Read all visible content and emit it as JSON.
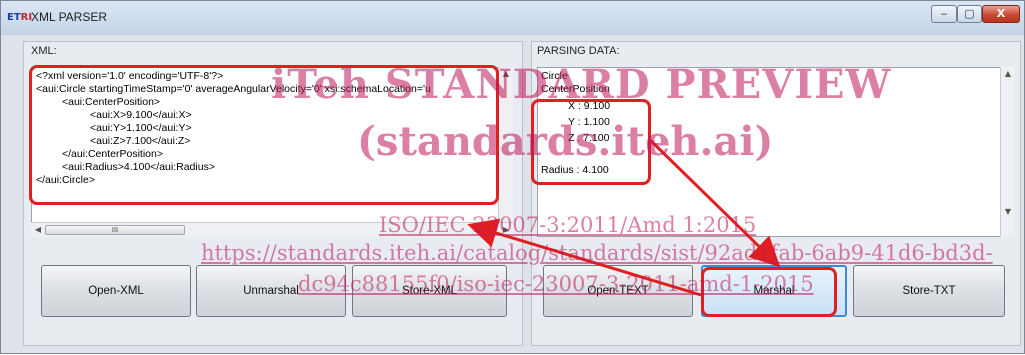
{
  "window": {
    "title": "XML PARSER",
    "icon_text_a": "ET",
    "icon_text_b": "RI",
    "min_glyph": "‒",
    "max_glyph": "▢",
    "close_glyph": "X"
  },
  "xml_panel": {
    "label": "XML:",
    "lines": [
      "<?xml version='1.0' encoding='UTF-8'?>",
      "<aui:Circle startingTimeStamp='0' averageAngularVelocity='0' xsi:schemaLocation='u",
      "<aui:CenterPosition>",
      "<aui:X>9.100</aui:X>",
      "<aui:Y>1.100</aui:Y>",
      "<aui:Z>7.100</aui:Z>",
      "</aui:CenterPosition>",
      "<aui:Radius>4.100</aui:Radius>",
      "</aui:Circle>"
    ],
    "scroll_thumb_glyph": "III"
  },
  "parse_panel": {
    "label": "PARSING DATA:",
    "lines": [
      "Circle",
      "CenterPosition",
      "X : 9.100",
      "Y : 1.100",
      "Z : 7.100",
      "",
      "Radius : 4.100"
    ]
  },
  "buttons": {
    "open_xml": "Open-XML",
    "unmarshal": "Unmarshal",
    "store_xml": "Store-XML",
    "open_text": "Open-TEXT",
    "marshal": "Marshal",
    "store_txt": "Store-TXT"
  },
  "watermark": {
    "line1": "iTeh STANDARD PREVIEW",
    "line2": "(standards.iteh.ai)",
    "line3": "ISO/IEC 23007-3:2011/Amd 1:2015",
    "line4": "https://standards.iteh.ai/catalog/standards/sist/92ad1fab-6ab9-41d6-bd3d-",
    "line5": "dc94c88155f0/iso-iec-23007-3-2011-amd-1-2015"
  },
  "colors": {
    "annotation_red": "#e02020",
    "watermark": "#c0185a",
    "focus_blue": "#3d8ad9"
  }
}
